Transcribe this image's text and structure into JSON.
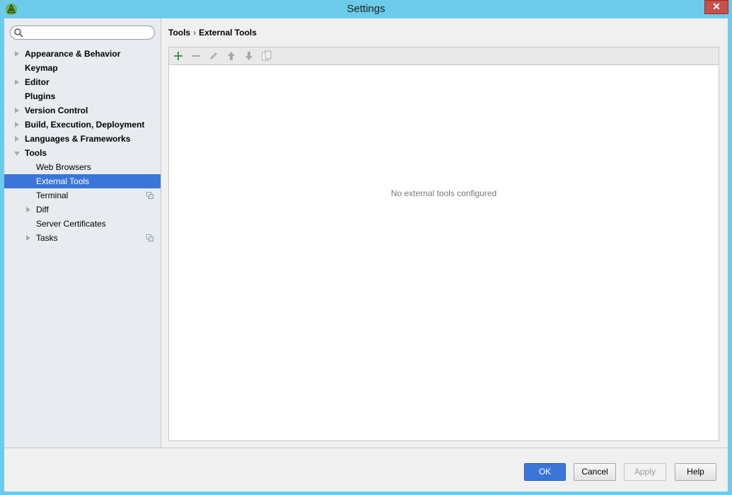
{
  "window": {
    "title": "Settings",
    "close_label": "✕"
  },
  "search": {
    "placeholder": "",
    "value": ""
  },
  "sidebar": {
    "items": [
      {
        "label": "Appearance & Behavior"
      },
      {
        "label": "Keymap"
      },
      {
        "label": "Editor"
      },
      {
        "label": "Plugins"
      },
      {
        "label": "Version Control"
      },
      {
        "label": "Build, Execution, Deployment"
      },
      {
        "label": "Languages & Frameworks"
      },
      {
        "label": "Tools"
      },
      {
        "label": "Web Browsers"
      },
      {
        "label": "External Tools"
      },
      {
        "label": "Terminal"
      },
      {
        "label": "Diff"
      },
      {
        "label": "Server Certificates"
      },
      {
        "label": "Tasks"
      }
    ],
    "selected": "External Tools"
  },
  "breadcrumb": {
    "parent": "Tools",
    "separator": "›",
    "current": "External Tools"
  },
  "toolbar": {
    "icons": [
      "add-icon",
      "remove-icon",
      "edit-icon",
      "move-up-icon",
      "move-down-icon",
      "copy-icon"
    ]
  },
  "panel": {
    "empty_text": "No external tools configured"
  },
  "footer": {
    "ok": "OK",
    "cancel": "Cancel",
    "apply": "Apply",
    "help": "Help"
  },
  "colors": {
    "titlebar": "#6ccbeb",
    "selection": "#3a75d7",
    "add_icon": "#3a9a3a"
  }
}
